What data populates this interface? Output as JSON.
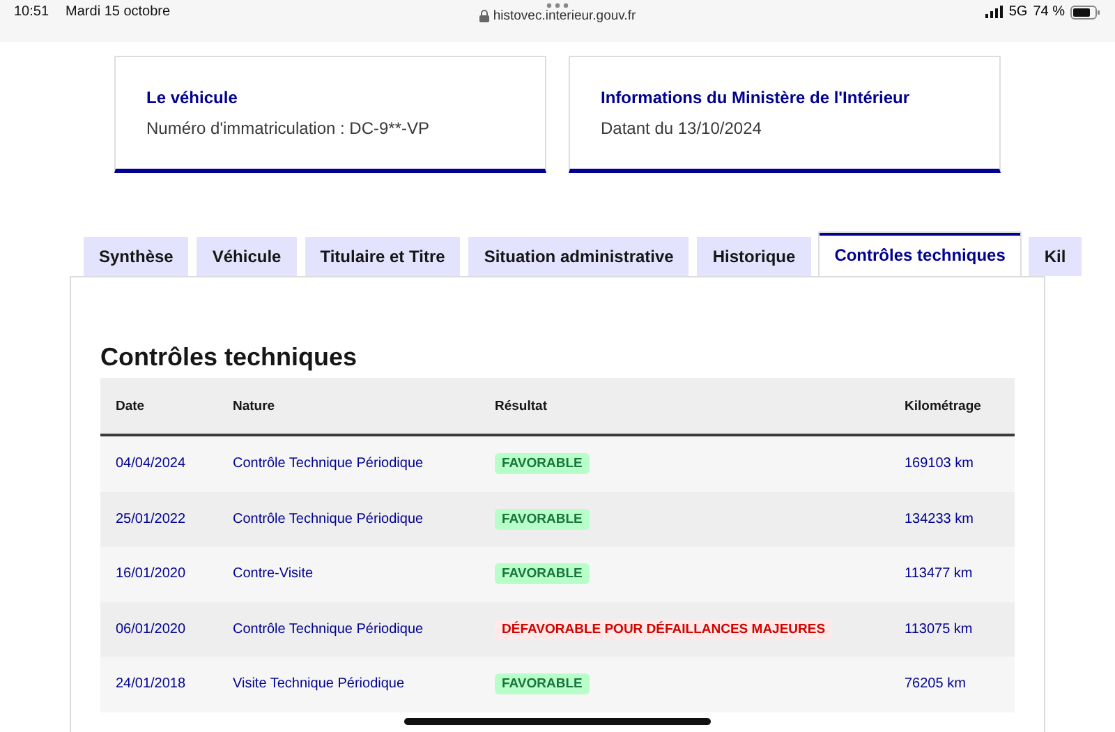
{
  "status_bar": {
    "time": "10:51",
    "date": "Mardi 15 octobre",
    "url": "histovec.interieur.gouv.fr",
    "network": "5G",
    "battery": "74 %"
  },
  "cards": [
    {
      "title": "Le véhicule",
      "text": "Numéro d'immatriculation : DC-9**-VP"
    },
    {
      "title": "Informations du Ministère de l'Intérieur",
      "text": "Datant du 13/10/2024"
    }
  ],
  "tabs": [
    {
      "label": "Synthèse",
      "selected": false
    },
    {
      "label": "Véhicule",
      "selected": false
    },
    {
      "label": "Titulaire et Titre",
      "selected": false
    },
    {
      "label": "Situation administrative",
      "selected": false
    },
    {
      "label": "Historique",
      "selected": false
    },
    {
      "label": "Contrôles techniques",
      "selected": true
    },
    {
      "label": "Kil",
      "selected": false
    }
  ],
  "section_title": "Contrôles techniques",
  "table": {
    "columns": [
      "Date",
      "Nature",
      "Résultat",
      "Kilométrage"
    ],
    "rows": [
      {
        "date": "04/04/2024",
        "nature": "Contrôle Technique Périodique",
        "result": {
          "text": "FAVORABLE",
          "kind": "success"
        },
        "km": "169103 km"
      },
      {
        "date": "25/01/2022",
        "nature": "Contrôle Technique Périodique",
        "result": {
          "text": "FAVORABLE",
          "kind": "success"
        },
        "km": "134233 km"
      },
      {
        "date": "16/01/2020",
        "nature": "Contre-Visite",
        "result": {
          "text": "FAVORABLE",
          "kind": "success"
        },
        "km": "113477 km"
      },
      {
        "date": "06/01/2020",
        "nature": "Contrôle Technique Périodique",
        "result": {
          "text": "DÉFAVORABLE POUR DÉFAILLANCES MAJEURES",
          "kind": "error"
        },
        "km": "113075 km"
      },
      {
        "date": "24/01/2018",
        "nature": "Visite Technique Périodique",
        "result": {
          "text": "FAVORABLE",
          "kind": "success"
        },
        "km": "76205 km"
      }
    ]
  }
}
